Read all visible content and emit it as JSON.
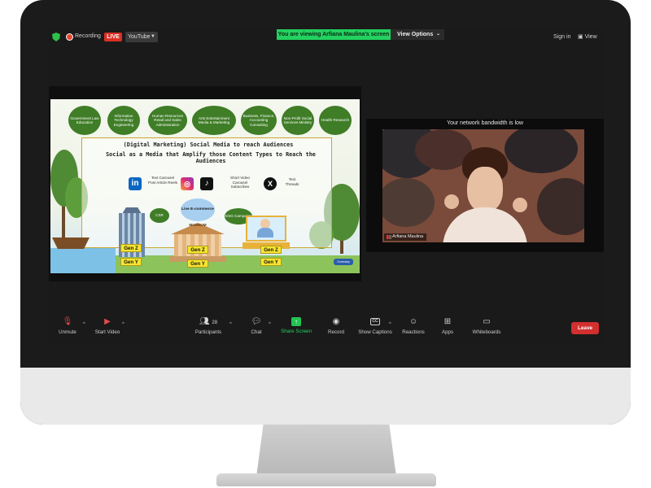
{
  "topbar": {
    "recording_label": "Recording",
    "live_badge": "LIVE",
    "stream_target": "YouTube",
    "viewing_banner": "You are viewing Arfiana Maulina's screen",
    "view_options": "View Options",
    "sign_in": "Sign in",
    "view": "View"
  },
  "slide": {
    "sectors": [
      "Government Law Education",
      "Information Technology Engineering",
      "Human Resources Retail and Sales Administration",
      "Arts Entertainment Media & Marketing",
      "Business, Finance, Accounting Consulting",
      "Non-Profit Social Services Ministry",
      "Health Research"
    ],
    "title1": "(Digital Marketing) Social Media to reach Audiences",
    "title2": "Social as a Media that Amplify those Content Types to Reach the Audiences",
    "linkedin_desc": "Text Carousel Post Article Reels",
    "shortvideo_desc": "Short Video Carousel Subscribes",
    "x_desc": "Text Threads",
    "csr": "CSR",
    "live_ecommerce": "Live E-commerce",
    "esg": "ESG Campaign",
    "museum_sign": "MUSEUM",
    "gen_z": "Gen Z",
    "gen_y": "Gen Y",
    "summary_tag": "Summary"
  },
  "video": {
    "bandwidth_notice": "Your network bandwidth is low",
    "participant_name": "Arfiana Maulina"
  },
  "toolbar": {
    "unmute": "Unmute",
    "start_video": "Start Video",
    "participants": "Participants",
    "participants_count": "28",
    "chat": "Chat",
    "share_screen": "Share Screen",
    "record": "Record",
    "show_captions": "Show Captions",
    "cc": "CC",
    "reactions": "Reactions",
    "apps": "Apps",
    "whiteboards": "Whiteboards",
    "leave": "Leave"
  },
  "colors": {
    "share_green": "#23d160",
    "leave_red": "#d32f2f",
    "live_red": "#d93025",
    "sector_green": "#3f7d27"
  },
  "icons": [
    "shield-icon",
    "record-dot-icon",
    "mic-muted-icon",
    "video-off-icon",
    "participants-icon",
    "chat-icon",
    "share-screen-icon",
    "record-icon",
    "captions-icon",
    "reactions-icon",
    "apps-icon",
    "whiteboard-icon",
    "linkedin-icon",
    "instagram-icon",
    "tiktok-icon",
    "x-icon"
  ]
}
